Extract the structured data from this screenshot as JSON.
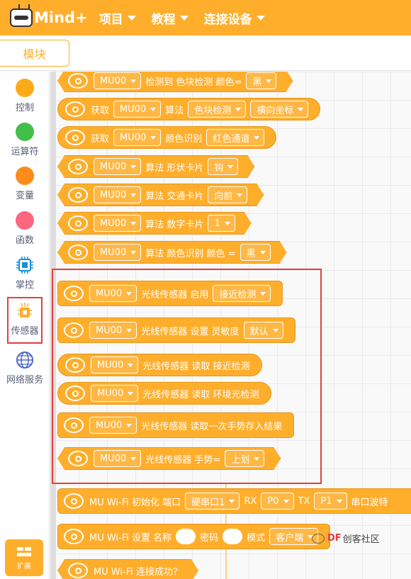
{
  "app": {
    "logo_text": "Mind+"
  },
  "menu": [
    {
      "label": "项目"
    },
    {
      "label": "教程"
    },
    {
      "label": "连接设备"
    }
  ],
  "module_tab": "模块",
  "categories": [
    {
      "label": "控制",
      "color": "#ffab19"
    },
    {
      "label": "运算符",
      "color": "#40bf4a"
    },
    {
      "label": "变量",
      "color": "#ff8c1a"
    },
    {
      "label": "函数",
      "color": "#ff6680"
    },
    {
      "label": "掌控",
      "color": "#0fbd8c"
    },
    {
      "label": "传感器",
      "color": "#ffae2c"
    },
    {
      "label": "网络服务",
      "color": "#4d67c7"
    }
  ],
  "extension_label": "扩展",
  "blocks": [
    {
      "dd1": "MU00",
      "t1": "检测到 色块检测 颜色=",
      "dd2": "黑"
    },
    {
      "t0": "获取",
      "dd1": "MU00",
      "t1": "算法",
      "dd2": "色块检测",
      "dd3": "横向坐标"
    },
    {
      "t0": "获取",
      "dd1": "MU00",
      "t1": "颜色识别",
      "dd2": "红色通道"
    },
    {
      "dd1": "MU00",
      "t1": "算法 形状卡片",
      "dd2": "钩"
    },
    {
      "dd1": "MU00",
      "t1": "算法 交通卡片",
      "dd2": "向前"
    },
    {
      "dd1": "MU00",
      "t1": "算法 数字卡片",
      "dd2": "1"
    },
    {
      "dd1": "MU00",
      "t1": "算法 颜色识别 颜色 =",
      "dd2": "黑"
    },
    {
      "dd1": "MU00",
      "t1": "光线传感器 启用",
      "dd2": "接近检测"
    },
    {
      "dd1": "MU00",
      "t1": "光线传感器 设置 灵敏度",
      "dd2": "默认"
    },
    {
      "dd1": "MU00",
      "t1": "光线传感器 读取 接近检测"
    },
    {
      "dd1": "MU00",
      "t1": "光线传感器 读取 环境光检测"
    },
    {
      "dd1": "MU00",
      "t1": "光线传感器 读取一次手势存入结果"
    },
    {
      "dd1": "MU00",
      "t1": "光线传感器 手势=",
      "dd2": "上划"
    },
    {
      "t1": "MU Wi-Fi 初始化 端口",
      "dd1": "硬串口1",
      "t2": "RX",
      "dd2": "P0",
      "t3": "TX",
      "dd3": "P1",
      "t4": "串口波特"
    },
    {
      "t1": "MU Wi-Fi 设置 名称",
      "t2": "密码",
      "t3": "模式",
      "dd1": "客户端"
    },
    {
      "t1": "MU Wi-Fi 连接成功？"
    }
  ],
  "watermark": {
    "df": "DF",
    "text": "创客社区"
  }
}
